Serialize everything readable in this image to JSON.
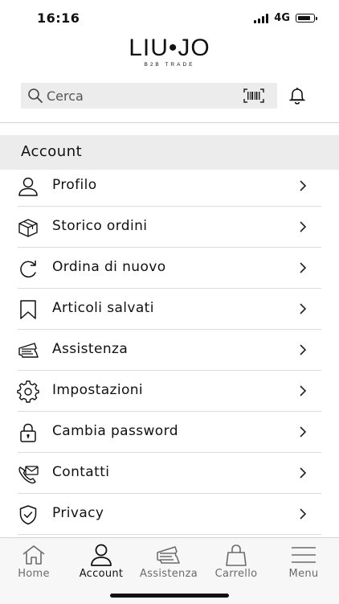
{
  "status_bar": {
    "time": "16:16",
    "network": "4G",
    "signal_bars": 4,
    "battery_level": 0.85
  },
  "logo": {
    "main": "LIU•JO",
    "sub": "B2B TRADE"
  },
  "search": {
    "placeholder": "Cerca",
    "icon": "search-icon",
    "scan_icon": "barcode-scan-icon"
  },
  "header": {
    "notification_icon": "bell-icon"
  },
  "section": {
    "title": "Account"
  },
  "menu": {
    "items": [
      {
        "label": "Profilo",
        "icon": "user-icon"
      },
      {
        "label": "Storico ordini",
        "icon": "box-icon"
      },
      {
        "label": "Ordina di nuovo",
        "icon": "reorder-icon"
      },
      {
        "label": "Articoli salvati",
        "icon": "bookmark-icon"
      },
      {
        "label": "Assistenza",
        "icon": "ticket-icon"
      },
      {
        "label": "Impostazioni",
        "icon": "gear-icon"
      },
      {
        "label": "Cambia password",
        "icon": "lock-icon"
      },
      {
        "label": "Contatti",
        "icon": "contact-icon"
      },
      {
        "label": "Privacy",
        "icon": "shield-icon"
      }
    ]
  },
  "tab_bar": {
    "active": "Account",
    "tabs": [
      {
        "label": "Home",
        "icon": "home-icon"
      },
      {
        "label": "Account",
        "icon": "account-icon"
      },
      {
        "label": "Assistenza",
        "icon": "ticket-icon"
      },
      {
        "label": "Carrello",
        "icon": "bag-icon"
      },
      {
        "label": "Menu",
        "icon": "hamburger-icon"
      }
    ]
  },
  "colors": {
    "background": "#ffffff",
    "header_bg": "#ececec",
    "text": "#111111",
    "tab_inactive": "#6b6b6b"
  }
}
